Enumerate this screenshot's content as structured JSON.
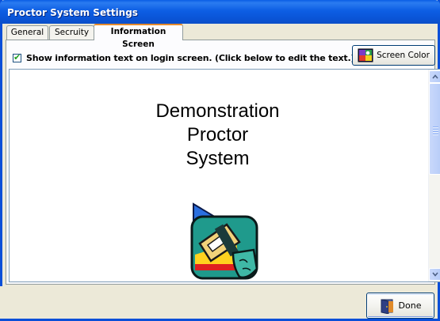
{
  "window": {
    "title": "Proctor System Settings"
  },
  "tabs": [
    {
      "label": "General"
    },
    {
      "label": "Secruity"
    },
    {
      "label": "Information Screen"
    }
  ],
  "info_screen": {
    "show_info_checkbox": {
      "label": "Show information text on login screen.  (Click below to edit the text.)",
      "checked": true
    },
    "screen_color_button": {
      "label": "Screen Color",
      "icon": "palette-icon"
    },
    "info_text_lines": [
      "Demonstration",
      "Proctor",
      "System"
    ],
    "logo_icon": "proctor-logo-icon"
  },
  "footer": {
    "done_button": {
      "label": "Done",
      "icon": "exit-door-icon"
    }
  },
  "colors": {
    "titlebar": "#0a55d8",
    "active_tab_accent": "#e68b2c",
    "logo_teal": "#1f9a8c",
    "logo_red": "#e02020",
    "logo_yellow": "#ffd21f"
  }
}
